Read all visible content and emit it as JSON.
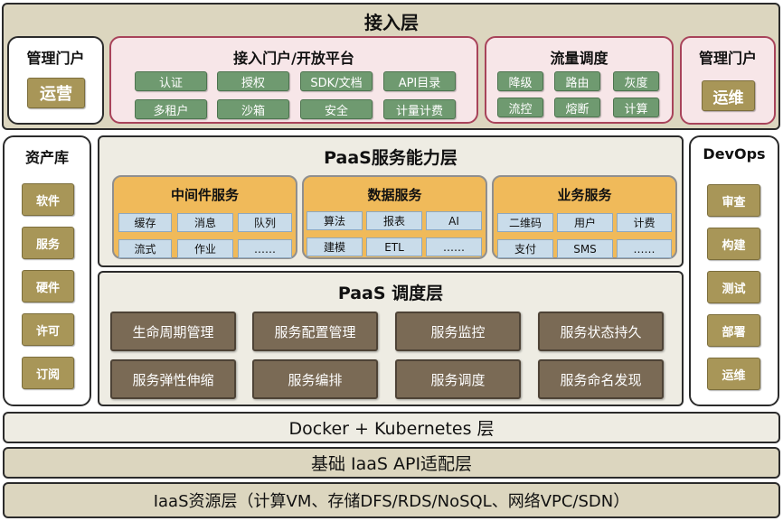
{
  "access_layer": {
    "title": "接入层",
    "mgmt_portal_left": {
      "title": "管理门户",
      "button": "运营"
    },
    "open_platform": {
      "title": "接入门户/开放平台",
      "row1": [
        "认证",
        "授权",
        "SDK/文档",
        "API目录"
      ],
      "row2": [
        "多租户",
        "沙箱",
        "安全",
        "计量计费"
      ]
    },
    "traffic": {
      "title": "流量调度",
      "row1": [
        "降级",
        "路由",
        "灰度"
      ],
      "row2": [
        "流控",
        "熔断",
        "计算"
      ]
    },
    "mgmt_portal_right": {
      "title": "管理门户",
      "button": "运维"
    }
  },
  "asset_library": {
    "title": "资产库",
    "items": [
      "软件",
      "服务",
      "硬件",
      "许可",
      "订阅"
    ]
  },
  "devops": {
    "title": "DevOps",
    "items": [
      "审查",
      "构建",
      "测试",
      "部署",
      "运维"
    ]
  },
  "paas_capability": {
    "title": "PaaS服务能力层",
    "middleware": {
      "title": "中间件服务",
      "row1": [
        "缓存",
        "消息",
        "队列"
      ],
      "row2": [
        "流式",
        "作业",
        "……"
      ]
    },
    "data": {
      "title": "数据服务",
      "row1": [
        "算法",
        "报表",
        "AI"
      ],
      "row2": [
        "建模",
        "ETL",
        "……"
      ]
    },
    "business": {
      "title": "业务服务",
      "row1": [
        "二维码",
        "用户",
        "计费"
      ],
      "row2": [
        "支付",
        "SMS",
        "……"
      ]
    }
  },
  "paas_scheduling": {
    "title": "PaaS 调度层",
    "row1": [
      "生命周期管理",
      "服务配置管理",
      "服务监控",
      "服务状态持久"
    ],
    "row2": [
      "服务弹性伸缩",
      "服务编排",
      "服务调度",
      "服务命名发现"
    ]
  },
  "docker_layer": "Docker + Kubernetes 层",
  "iaas_api_layer": "基础 IaaS API适配层",
  "iaas_resource_layer": "IaaS资源层（计算VM、存储DFS/RDS/NoSQL、网络VPC/SDN）",
  "colors": {
    "beige": "#dcd6bf",
    "pink_fill": "#f7e6e8",
    "pink_border": "#a8435a",
    "green": "#6f9a70",
    "olive": "#a89658",
    "orange": "#f0ba5a",
    "light_blue": "#c9dcea",
    "brown": "#7a6a55"
  }
}
